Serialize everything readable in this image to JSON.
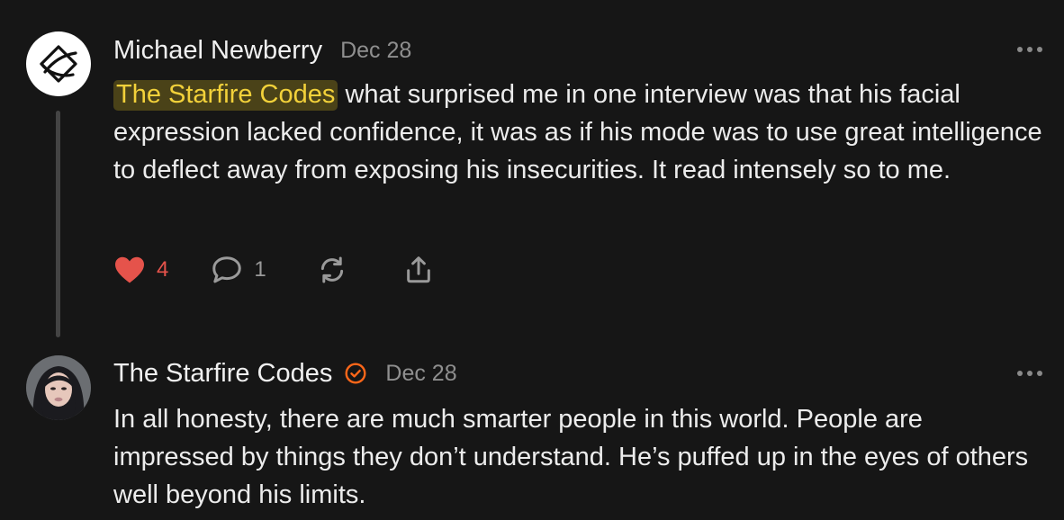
{
  "comments": [
    {
      "author": "Michael Newberry",
      "date": "Dec 28",
      "mention": "The Starfire Codes",
      "text": " what surprised me in one interview was that his facial expression lacked confidence, it was as if his mode was to use great intelligence to deflect away from exposing his insecurities. It read intensely so to me.",
      "avatar_icon": "abstract-logo-icon",
      "likes": "4",
      "replies": "1",
      "liked": true
    },
    {
      "author": "The Starfire Codes",
      "verified": true,
      "date": "Dec 28",
      "text": "In all honesty, there are much smarter people in this world. People are impressed by things they don’t understand. He’s puffed up in the eyes of others well beyond his limits.",
      "avatar_icon": "profile-photo"
    }
  ],
  "icons": {
    "like": "heart-icon",
    "reply": "comment-bubble-icon",
    "restack": "restack-icon",
    "share": "share-icon",
    "more": "more-options-icon",
    "verified": "verified-check-icon"
  },
  "colors": {
    "background": "#161616",
    "like_active": "#e5534b",
    "mention_text": "#f2d13a",
    "mention_bg": "#4a4218",
    "verified": "#ff6719"
  }
}
